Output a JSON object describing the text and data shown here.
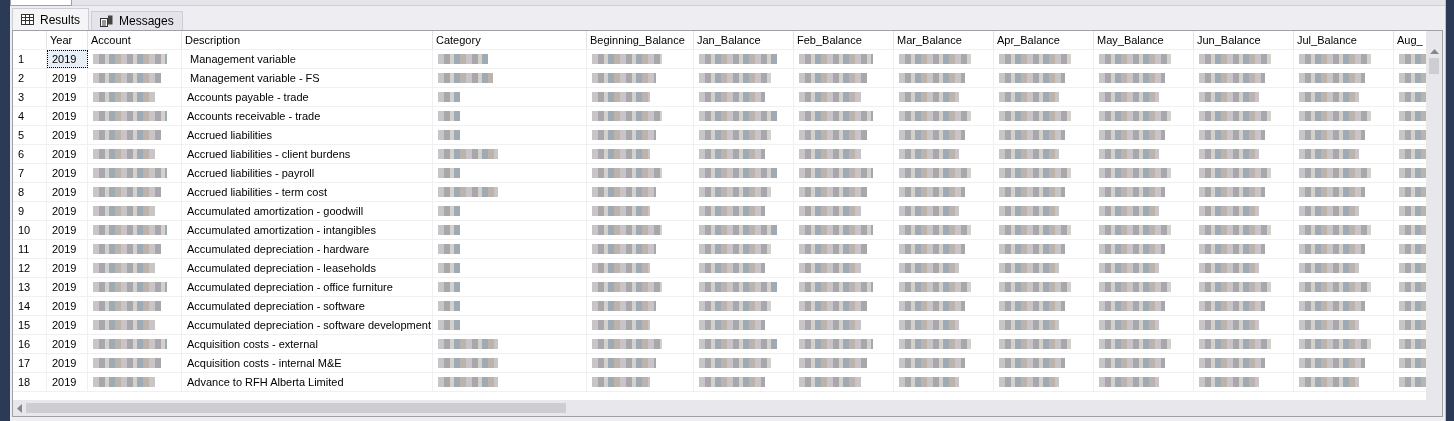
{
  "tabs": [
    {
      "label": "Results",
      "selected": true,
      "kind": "grid"
    },
    {
      "label": "Messages",
      "selected": false,
      "kind": "messages"
    }
  ],
  "grid": {
    "columns": [
      "Year",
      "Account",
      "Description",
      "Category",
      "Beginning_Balance",
      "Jan_Balance",
      "Feb_Balance",
      "Mar_Balance",
      "Apr_Balance",
      "May_Balance",
      "Jun_Balance",
      "Jul_Balance",
      "Aug_"
    ],
    "rows": [
      {
        "number": "1",
        "year": "2019",
        "description": " Management variable",
        "selected": true
      },
      {
        "number": "2",
        "year": "2019",
        "description": " Management variable - FS",
        "selected": false
      },
      {
        "number": "3",
        "year": "2019",
        "description": "Accounts payable - trade",
        "selected": false
      },
      {
        "number": "4",
        "year": "2019",
        "description": "Accounts receivable - trade",
        "selected": false
      },
      {
        "number": "5",
        "year": "2019",
        "description": "Accrued liabilities",
        "selected": false
      },
      {
        "number": "6",
        "year": "2019",
        "description": "Accrued liabilities - client burdens",
        "selected": false
      },
      {
        "number": "7",
        "year": "2019",
        "description": "Accrued liabilities - payroll",
        "selected": false
      },
      {
        "number": "8",
        "year": "2019",
        "description": "Accrued liabilities - term cost",
        "selected": false
      },
      {
        "number": "9",
        "year": "2019",
        "description": "Accumulated amortization - goodwill",
        "selected": false
      },
      {
        "number": "10",
        "year": "2019",
        "description": "Accumulated amortization - intangibles",
        "selected": false
      },
      {
        "number": "11",
        "year": "2019",
        "description": "Accumulated depreciation - hardware",
        "selected": false
      },
      {
        "number": "12",
        "year": "2019",
        "description": "Accumulated depreciation - leaseholds",
        "selected": false
      },
      {
        "number": "13",
        "year": "2019",
        "description": "Accumulated depreciation - office furniture",
        "selected": false
      },
      {
        "number": "14",
        "year": "2019",
        "description": "Accumulated depreciation - software",
        "selected": false
      },
      {
        "number": "15",
        "year": "2019",
        "description": "Accumulated depreciation - software development",
        "selected": false
      },
      {
        "number": "16",
        "year": "2019",
        "description": "Acquisition costs - external",
        "selected": false
      },
      {
        "number": "17",
        "year": "2019",
        "description": "Acquisition costs - internal M&E",
        "selected": false
      },
      {
        "number": "18",
        "year": "2019",
        "description": "Advance to RFH Alberta Limited",
        "selected": false
      }
    ]
  }
}
